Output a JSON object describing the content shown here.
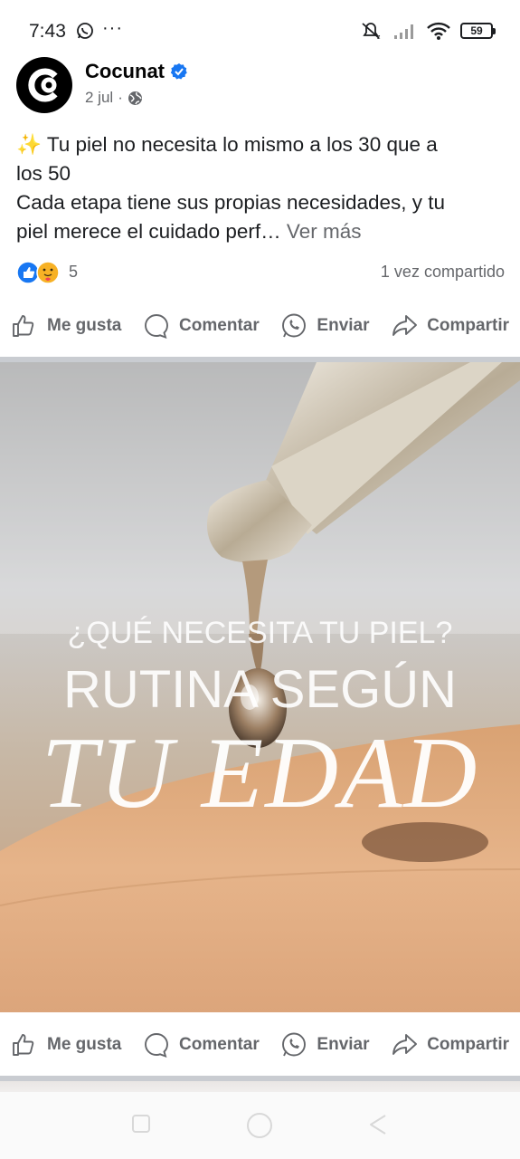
{
  "status_bar": {
    "time": "7:43",
    "more": "···",
    "battery": "59"
  },
  "post": {
    "author": "Cocunat",
    "date": "2 jul",
    "separator": "·",
    "text_lines": [
      "✨ Tu piel no necesita lo mismo a los 30 que a",
      "los 50",
      "Cada etapa tiene sus propias necesidades, y tu",
      "piel merece el cuidado perf…"
    ],
    "see_more": "Ver más",
    "reaction_count": "5",
    "shares": "1 vez compartido",
    "image_text": {
      "line1": "¿QUÉ NECESITA TU PIEL?",
      "line2": "RUTINA SEGÚN",
      "line3": "TU EDAD"
    }
  },
  "actions": {
    "like": "Me gusta",
    "comment": "Comentar",
    "send": "Enviar",
    "share": "Compartir"
  },
  "colors": {
    "text": "#1c1e21",
    "muted": "#65676b",
    "verified": "#1877f2",
    "like": "#1877f2",
    "care": "#f7b125"
  }
}
